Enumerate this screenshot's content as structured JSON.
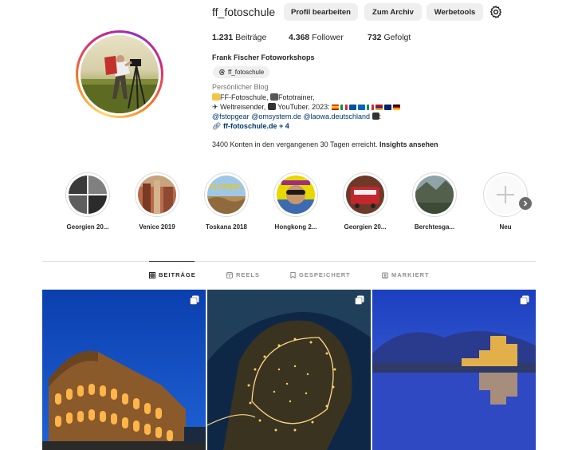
{
  "profile": {
    "username": "ff_fotoschule",
    "buttons": {
      "edit": "Profil bearbeiten",
      "archive": "Zum Archiv",
      "tools": "Werbetools"
    },
    "stats": {
      "posts_count": "1.231",
      "posts_label": "Beiträge",
      "followers_count": "4.368",
      "followers_label": "Follower",
      "following_count": "732",
      "following_label": "Gefolgt"
    },
    "full_name": "Frank Fischer Fotoworkshops",
    "threads_handle": "ff_fotoschule",
    "category": "Persönlicher Blog",
    "bio": {
      "line1": "FF-Fotoschule,",
      "line1b": "Fototrainer,",
      "line2a": "Weltreisender,",
      "line2b": "YouTuber. 2023:",
      "line3_mention1": "@fstopgear",
      "line3_mention2": "@omsystem.de",
      "line3_mention3": "@laowa.deutschland",
      "line3_suffix": ":",
      "link": "ff-fotoschule.de + 4"
    },
    "insights": {
      "text": "3400 Konten in den vergangenen 30 Tagen erreicht.",
      "link": "Insights ansehen"
    }
  },
  "highlights": [
    {
      "label": "Georgien 20..."
    },
    {
      "label": "Venice 2019"
    },
    {
      "label": "Toskana 2018",
      "badge": "FLYOVER.."
    },
    {
      "label": "Hongkong 2..."
    },
    {
      "label": "Georgien 20..."
    },
    {
      "label": "Berchtesga..."
    },
    {
      "label": "Neu"
    }
  ],
  "tabs": [
    {
      "label": "BEITRÄGE",
      "active": true,
      "icon": "grid-icon"
    },
    {
      "label": "REELS",
      "active": false,
      "icon": "reels-icon"
    },
    {
      "label": "GESPEICHERT",
      "active": false,
      "icon": "bookmark-icon"
    },
    {
      "label": "MARKIERT",
      "active": false,
      "icon": "tagged-icon"
    }
  ],
  "posts": [
    {
      "subject": "colosseum-night",
      "multi": true
    },
    {
      "subject": "aerial-town-night",
      "multi": true
    },
    {
      "subject": "castle-lake-blue-hour",
      "multi": true
    }
  ],
  "colors": {
    "link": "#00376b",
    "muted": "#737373",
    "button_bg": "#efefef",
    "divider": "#dbdbdb"
  }
}
